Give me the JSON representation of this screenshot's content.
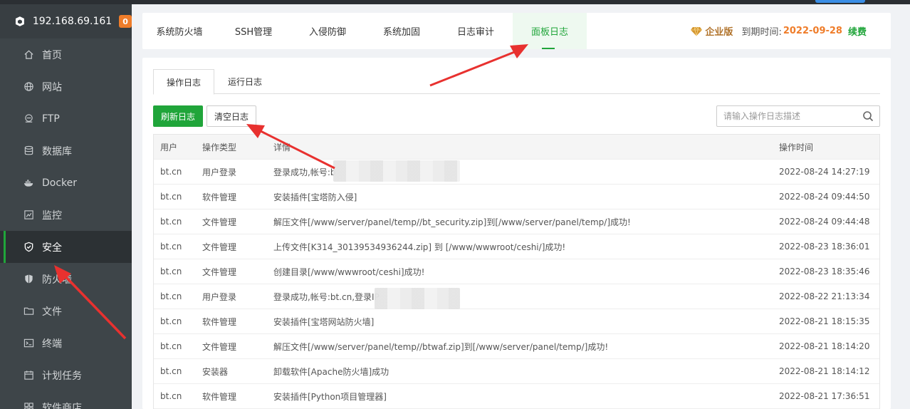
{
  "sidebar": {
    "server_ip": "192.168.69.161",
    "badge": "0",
    "items": [
      {
        "label": "首页",
        "icon": "home-icon"
      },
      {
        "label": "网站",
        "icon": "globe-icon"
      },
      {
        "label": "FTP",
        "icon": "ftp-icon"
      },
      {
        "label": "数据库",
        "icon": "database-icon"
      },
      {
        "label": "Docker",
        "icon": "docker-icon"
      },
      {
        "label": "监控",
        "icon": "monitor-icon"
      },
      {
        "label": "安全",
        "icon": "shield-check-icon"
      },
      {
        "label": "防火墙",
        "icon": "shield-icon"
      },
      {
        "label": "文件",
        "icon": "folder-icon"
      },
      {
        "label": "终端",
        "icon": "terminal-icon"
      },
      {
        "label": "计划任务",
        "icon": "calendar-icon"
      },
      {
        "label": "软件商店",
        "icon": "grid-icon"
      }
    ]
  },
  "top_tabs": [
    "系统防火墙",
    "SSH管理",
    "入侵防御",
    "系统加固",
    "日志审计",
    "面板日志"
  ],
  "license": {
    "edition": "企业版",
    "expire_label": "到期时间:",
    "expire_date": "2022-09-28",
    "renew": "续费"
  },
  "sub_tabs": [
    "操作日志",
    "运行日志"
  ],
  "buttons": {
    "refresh": "刷新日志",
    "clear": "清空日志"
  },
  "search": {
    "placeholder": "请输入操作日志描述"
  },
  "table": {
    "headers": [
      "用户",
      "操作类型",
      "详情",
      "操作时间"
    ],
    "rows": [
      {
        "user": "bt.cn",
        "type": "用户登录",
        "detail": "登录成功,帐号:b",
        "time": "2022-08-24 14:27:19"
      },
      {
        "user": "bt.cn",
        "type": "软件管理",
        "detail": "安装插件[宝塔防入侵]",
        "time": "2022-08-24 09:44:50"
      },
      {
        "user": "bt.cn",
        "type": "文件管理",
        "detail": "解压文件[/www/server/panel/temp//bt_security.zip]到[/www/server/panel/temp/]成功!",
        "time": "2022-08-24 09:44:48"
      },
      {
        "user": "bt.cn",
        "type": "文件管理",
        "detail": "上传文件[K314_30139534936244.zip] 到 [/www/wwwroot/ceshi/]成功!",
        "time": "2022-08-23 18:36:01"
      },
      {
        "user": "bt.cn",
        "type": "文件管理",
        "detail": "创建目录[/www/wwwroot/ceshi]成功!",
        "time": "2022-08-23 18:35:46"
      },
      {
        "user": "bt.cn",
        "type": "用户登录",
        "detail": "登录成功,帐号:bt.cn,登录IP",
        "time": "2022-08-22 21:13:34"
      },
      {
        "user": "bt.cn",
        "type": "软件管理",
        "detail": "安装插件[宝塔网站防火墙]",
        "time": "2022-08-21 18:15:35"
      },
      {
        "user": "bt.cn",
        "type": "文件管理",
        "detail": "解压文件[/www/server/panel/temp//btwaf.zip]到[/www/server/panel/temp/]成功!",
        "time": "2022-08-21 18:14:20"
      },
      {
        "user": "bt.cn",
        "type": "安装器",
        "detail": "卸载软件[Apache防火墙]成功",
        "time": "2022-08-21 18:14:12"
      },
      {
        "user": "bt.cn",
        "type": "软件管理",
        "detail": "安装插件[Python项目管理器]",
        "time": "2022-08-21 17:36:51"
      }
    ]
  },
  "colors": {
    "accent": "#20a53a",
    "sidebar": "#3e4549",
    "orange": "#ef7d2a",
    "annotation": "#e8312f"
  }
}
